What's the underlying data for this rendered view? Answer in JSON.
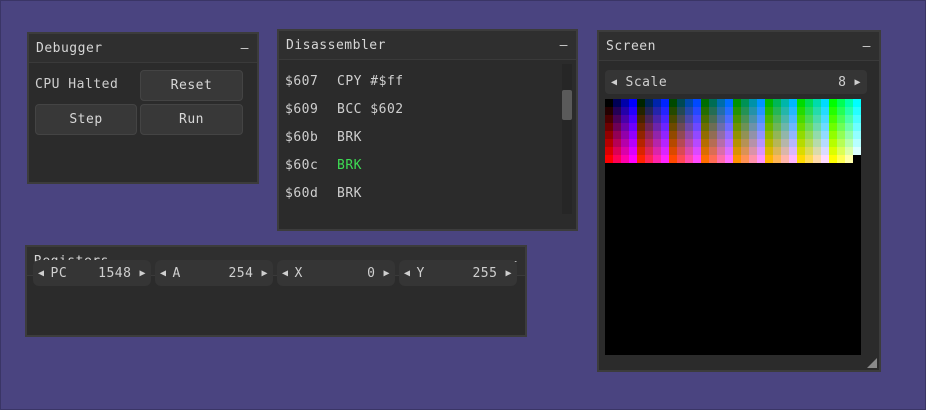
{
  "debugger": {
    "title": "Debugger",
    "collapse": "–",
    "status": "CPU Halted",
    "buttons": {
      "reset": "Reset",
      "step": "Step",
      "run": "Run"
    }
  },
  "disassembler": {
    "title": "Disassembler",
    "collapse": "–",
    "lines": [
      {
        "addr": "$607",
        "instr": "CPY #$ff",
        "current": false
      },
      {
        "addr": "$609",
        "instr": "BCC $602",
        "current": false
      },
      {
        "addr": "$60b",
        "instr": "BRK",
        "current": false
      },
      {
        "addr": "$60c",
        "instr": "BRK",
        "current": true
      },
      {
        "addr": "$60d",
        "instr": "BRK",
        "current": false
      }
    ],
    "current_color": "#3ddc53"
  },
  "screen": {
    "title": "Screen",
    "collapse": "–",
    "scale_label": "Scale",
    "scale_value": "8"
  },
  "registers": {
    "title": "Registers",
    "collapse": "–",
    "items": [
      {
        "name": "PC",
        "value": "1548"
      },
      {
        "name": "A",
        "value": "254"
      },
      {
        "name": "X",
        "value": "0"
      },
      {
        "name": "Y",
        "value": "255"
      }
    ]
  }
}
